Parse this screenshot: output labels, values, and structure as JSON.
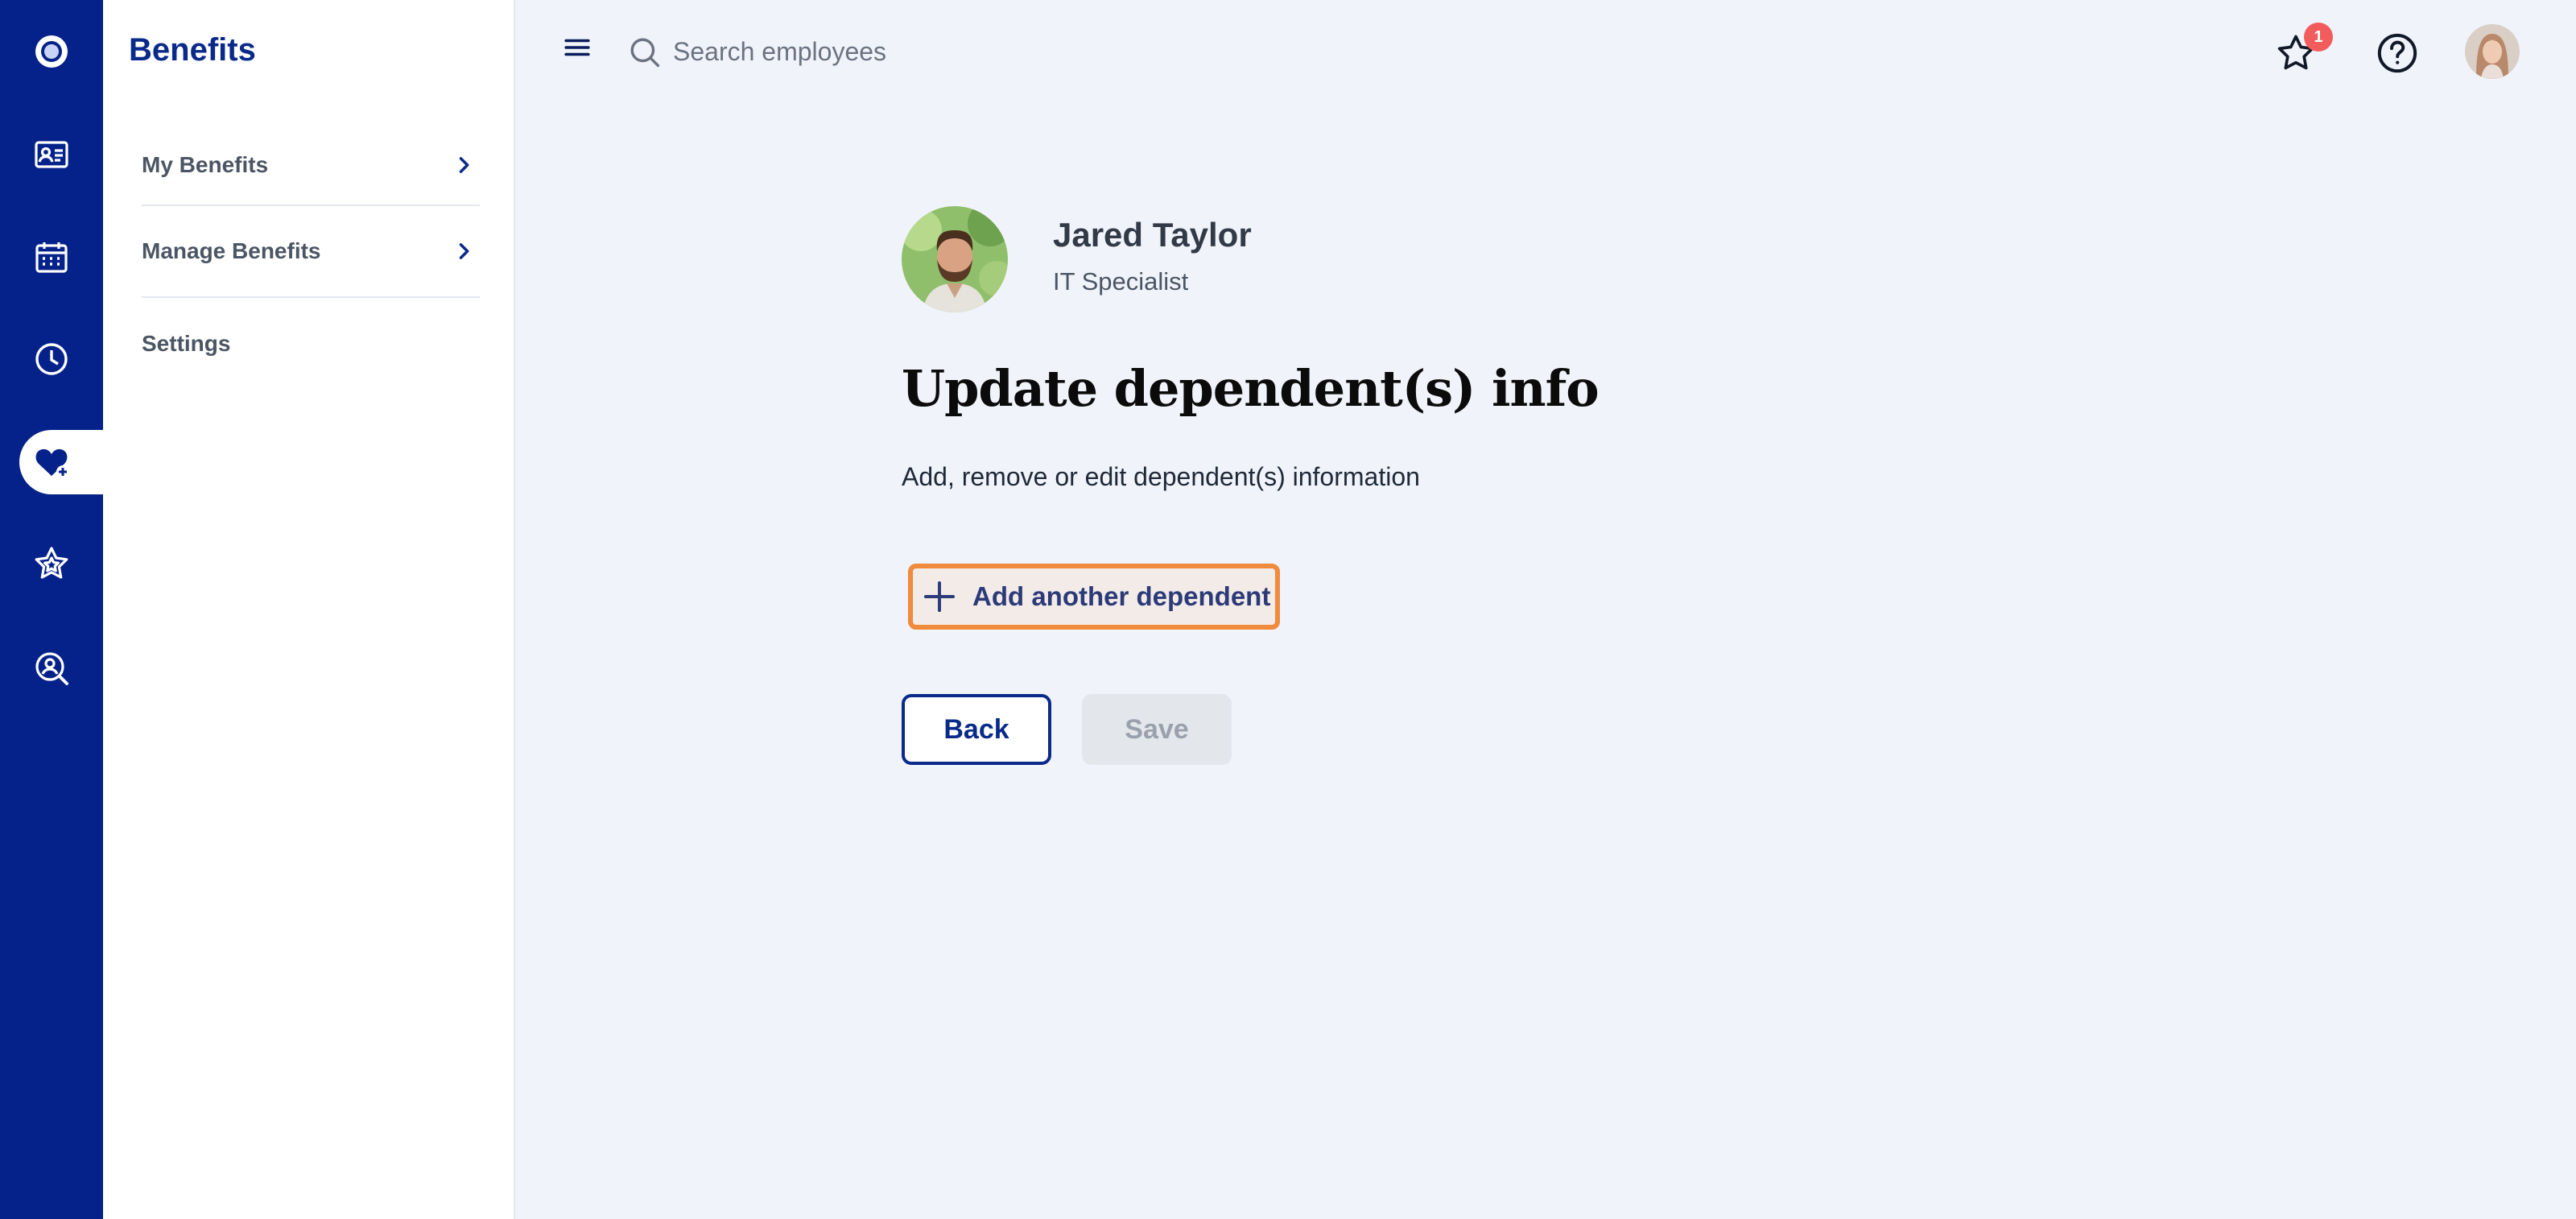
{
  "sidebar": {
    "title": "Benefits",
    "items": [
      {
        "label": "My Benefits",
        "has_chevron": true
      },
      {
        "label": "Manage Benefits",
        "has_chevron": true
      },
      {
        "label": "Settings",
        "has_chevron": false
      }
    ]
  },
  "rail": {
    "icons": [
      "logo-icon",
      "id-card-icon",
      "calendar-icon",
      "clock-icon",
      "heart-benefits-icon",
      "star-icon",
      "search-person-icon"
    ],
    "active": "heart-benefits-icon"
  },
  "topbar": {
    "search_placeholder": "Search employees",
    "notification_count": "1"
  },
  "employee": {
    "name": "Jared Taylor",
    "role": "IT Specialist"
  },
  "main": {
    "title": "Update dependent(s) info",
    "description": "Add, remove or edit dependent(s) information",
    "add_label": "Add another dependent",
    "back_label": "Back",
    "save_label": "Save"
  },
  "colors": {
    "rail_bg": "#05228a",
    "accent": "#0a2a8a",
    "highlight_border": "#f08a3c",
    "badge": "#f25c5c",
    "page_bg": "#f0f3fa"
  }
}
